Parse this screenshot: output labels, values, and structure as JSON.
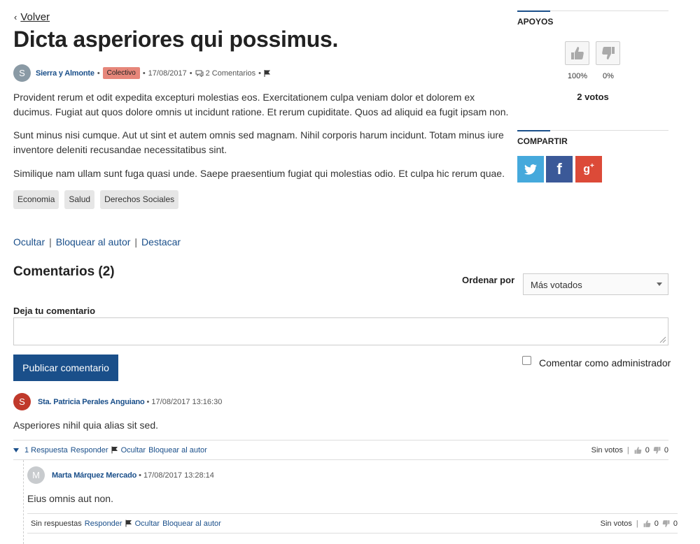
{
  "nav": {
    "back_label": "Volver"
  },
  "proposal": {
    "title": "Dicta asperiores qui possimus.",
    "author_initial": "S",
    "author": "Sierra y Almonte",
    "badge": "Colectivo",
    "date": "17/08/2017",
    "comments_count": "2 Comentarios",
    "paragraphs": [
      "Provident rerum et odit expedita excepturi molestias eos. Exercitationem culpa veniam dolor et dolorem ex ducimus. Fugiat aut quos dolore omnis ut incidunt ratione. Et rerum cupiditate. Quos ad aliquid ea fugit ipsam non.",
      "Sunt minus nisi cumque. Aut ut sint et autem omnis sed magnam. Nihil corporis harum incidunt. Totam minus iure inventore deleniti recusandae necessitatibus sint.",
      "Similique nam ullam sunt fuga quasi unde. Saepe praesentium fugiat qui molestias odio. Et culpa hic rerum quae."
    ],
    "tags": [
      "Economia",
      "Salud",
      "Derechos Sociales"
    ],
    "moderation": {
      "hide": "Ocultar",
      "block": "Bloquear al autor",
      "feature": "Destacar"
    }
  },
  "sidebar": {
    "supports_title": "APOYOS",
    "up_pct": "100%",
    "down_pct": "0%",
    "votes_total": "2 votos",
    "share_title": "COMPARTIR",
    "share_icons": [
      "twitter-icon",
      "facebook-icon",
      "google-plus-icon"
    ]
  },
  "comments": {
    "title": "Comentarios (2)",
    "order_label": "Ordenar por",
    "order_value": "Más votados",
    "leave_label": "Deja tu comentario",
    "publish_label": "Publicar comentario",
    "admin_label": "Comentar como administrador",
    "items": [
      {
        "initial": "S",
        "author": "Sta. Patricia Perales Anguiano",
        "date": "17/08/2017 13:16:30",
        "body": "Asperiores nihil quia alias sit sed.",
        "replies_label": "1 Respuesta",
        "reply": "Responder",
        "hide": "Ocultar",
        "block": "Bloquear al autor",
        "votes_label": "Sin votos",
        "up": "0",
        "down": "0"
      },
      {
        "initial": "M",
        "author": "Marta Márquez Mercado",
        "date": "17/08/2017 13:28:14",
        "body": "Eius omnis aut non.",
        "replies_label": "Sin respuestas",
        "reply": "Responder",
        "hide": "Ocultar",
        "block": "Bloquear al autor",
        "votes_label": "Sin votos",
        "up": "0",
        "down": "0"
      }
    ]
  },
  "colors": {
    "link": "#1a4f8a",
    "badge": "#e6867a",
    "twitter": "#45a9dc",
    "facebook": "#3b5998",
    "google": "#dc4a38"
  }
}
